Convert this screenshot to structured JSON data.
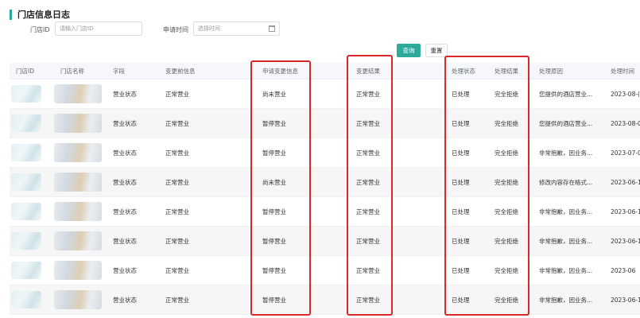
{
  "page_title": "门店信息日志",
  "filters": {
    "store_id_label": "门店ID",
    "store_id_placeholder": "请输入门店ID",
    "apply_time_label": "申请时间",
    "apply_time_placeholder": "选择时间"
  },
  "buttons": {
    "query": "查询",
    "reset": "重置"
  },
  "table": {
    "headers": [
      "门店ID",
      "门店名称",
      "字段",
      "变更前信息",
      "申请变更信息",
      "变更结果",
      "处理状态",
      "处理结果",
      "处理原因",
      "处理时间"
    ],
    "rows": [
      {
        "field": "营业状态",
        "before": "正常营业",
        "apply": "尚未营业",
        "result": "正常营业",
        "status": "已处理",
        "outcome": "完全拒绝",
        "reason": "您提供的酒店营业...",
        "time": "2023-08-("
      },
      {
        "field": "营业状态",
        "before": "正常营业",
        "apply": "暂停营业",
        "result": "正常营业",
        "status": "已处理",
        "outcome": "完全拒绝",
        "reason": "您提供的酒店营业...",
        "time": "2023-08-0"
      },
      {
        "field": "营业状态",
        "before": "正常营业",
        "apply": "暂停营业",
        "result": "正常营业",
        "status": "已处理",
        "outcome": "完全拒绝",
        "reason": "非常抱歉，因业务...",
        "time": "2023-07-0"
      },
      {
        "field": "营业状态",
        "before": "正常营业",
        "apply": "尚未营业",
        "result": "正常营业",
        "status": "已处理",
        "outcome": "完全拒绝",
        "reason": "修改内容存在格式...",
        "time": "2023-06-1"
      },
      {
        "field": "营业状态",
        "before": "正常营业",
        "apply": "暂停营业",
        "result": "正常营业",
        "status": "已处理",
        "outcome": "完全拒绝",
        "reason": "非常抱歉，因业务...",
        "time": "2023-06-1"
      },
      {
        "field": "营业状态",
        "before": "正常营业",
        "apply": "暂停营业",
        "result": "正常营业",
        "status": "已处理",
        "outcome": "完全拒绝",
        "reason": "非常抱歉，因业务...",
        "time": "2023-06-1"
      },
      {
        "field": "营业状态",
        "before": "正常营业",
        "apply": "暂停营业",
        "result": "正常营业",
        "status": "已处理",
        "outcome": "完全拒绝",
        "reason": "非常抱歉，因业务...",
        "time": "2023-06"
      },
      {
        "field": "营业状态",
        "before": "正常营业",
        "apply": "暂停营业",
        "result": "正常营业",
        "status": "已处理",
        "outcome": "完全拒绝",
        "reason": "非常抱歉，因业务...",
        "time": "2023-06-1"
      }
    ]
  },
  "colors": {
    "accent": "#2dab9a",
    "highlight": "#d9282a"
  }
}
